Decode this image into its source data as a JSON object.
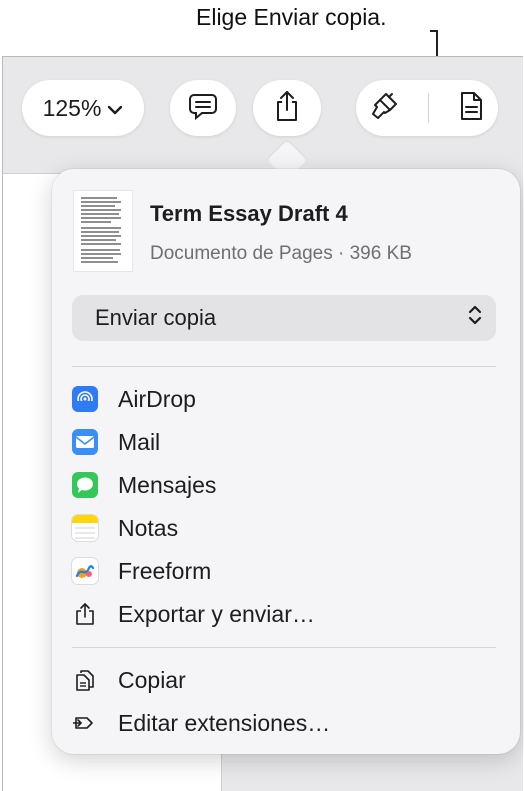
{
  "callout": {
    "text": "Elige Enviar copia."
  },
  "toolbar": {
    "zoom_label": "125%"
  },
  "document": {
    "title": "Term Essay Draft 4",
    "subtitle": "Documento de Pages · 396 KB"
  },
  "mode_select": {
    "value": "Enviar copia"
  },
  "share_targets": [
    {
      "label": "AirDrop",
      "icon": "airdrop-icon",
      "color": "#2f7bf5"
    },
    {
      "label": "Mail",
      "icon": "mail-icon",
      "color": "#3a8ff7"
    },
    {
      "label": "Mensajes",
      "icon": "messages-icon",
      "color": "#34c759"
    },
    {
      "label": "Notas",
      "icon": "notes-icon",
      "color": "#ffd60a"
    },
    {
      "label": "Freeform",
      "icon": "freeform-icon",
      "color": "#ffffff"
    },
    {
      "label": "Exportar y enviar…",
      "icon": "export-icon",
      "color": "#1d1d1f"
    }
  ],
  "actions": [
    {
      "label": "Copiar",
      "icon": "copy-icon"
    },
    {
      "label": "Editar extensiones…",
      "icon": "extensions-icon"
    }
  ],
  "colors": {
    "popover_bg": "#f5f5f7",
    "select_bg": "#e3e3e6",
    "window_bg": "#e8e8ea"
  }
}
